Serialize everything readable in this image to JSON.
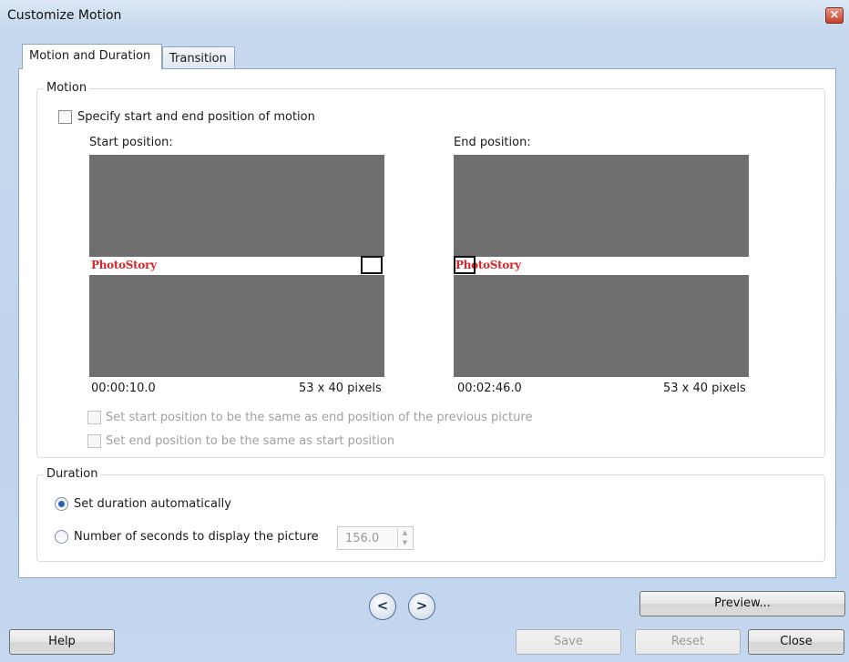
{
  "window": {
    "title": "Customize Motion",
    "close_glyph": "×"
  },
  "tabs": [
    {
      "label": "Motion and Duration",
      "active": true
    },
    {
      "label": "Transition",
      "active": false
    }
  ],
  "motion": {
    "group_label": "Motion",
    "specify_label": "Specify start and end position of motion",
    "specify_checked": false,
    "start": {
      "label": "Start position:",
      "time": "00:00:10.0",
      "size": "53 x 40 pixels",
      "logo_text": "PhotoStory"
    },
    "end": {
      "label": "End position:",
      "time": "00:02:46.0",
      "size": "53 x 40 pixels",
      "logo_text": "PhotoStory"
    },
    "same_as_prev_label": "Set start position to be the same as end position of the previous picture",
    "same_as_start_label": "Set end position to be the same as start position"
  },
  "duration": {
    "group_label": "Duration",
    "auto_label": "Set duration automatically",
    "auto_selected": true,
    "seconds_label": "Number of seconds to display the picture",
    "seconds_value": "156.0"
  },
  "nav": {
    "prev_glyph": "<",
    "next_glyph": ">"
  },
  "buttons": {
    "preview": "Preview...",
    "help": "Help",
    "save": "Save",
    "reset": "Reset",
    "close": "Close"
  },
  "colors": {
    "preview_bg": "#6e6e6e",
    "logo": "#d3262c",
    "radio_dot": "#2b62b8"
  }
}
